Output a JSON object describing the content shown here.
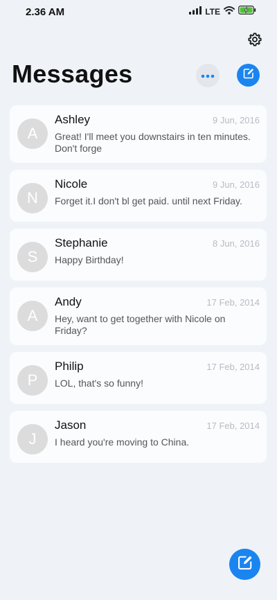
{
  "status_bar": {
    "time": "2.36 AM",
    "network": "LTE"
  },
  "header": {
    "title": "Messages"
  },
  "icons": {
    "settings": "gear-icon",
    "more": "ellipsis-icon",
    "compose": "compose-icon",
    "signal": "signal-icon",
    "wifi": "wifi-icon",
    "battery": "battery-charging-icon"
  },
  "colors": {
    "accent": "#1a85f0",
    "background": "#eff3f8",
    "card": "#fafcfe",
    "avatar": "#dcdcdc"
  },
  "conversations": [
    {
      "initial": "A",
      "name": "Ashley",
      "date": "9 Jun, 2016",
      "preview": "Great! I'll meet you downstairs in ten minutes. Don't forge"
    },
    {
      "initial": "N",
      "name": "Nicole",
      "date": "9 Jun, 2016",
      "preview": "Forget it.I don't bl get paid. until next Friday."
    },
    {
      "initial": "S",
      "name": "Stephanie",
      "date": "8 Jun, 2016",
      "preview": "Happy Birthday!"
    },
    {
      "initial": "A",
      "name": "Andy",
      "date": "17 Feb, 2014",
      "preview": "Hey, want to get together with Nicole on Friday?"
    },
    {
      "initial": "P",
      "name": "Philip",
      "date": "17 Feb, 2014",
      "preview": "LOL, that's so funny!"
    },
    {
      "initial": "J",
      "name": "Jason",
      "date": "17 Feb, 2014",
      "preview": "I heard you're moving to China."
    }
  ]
}
